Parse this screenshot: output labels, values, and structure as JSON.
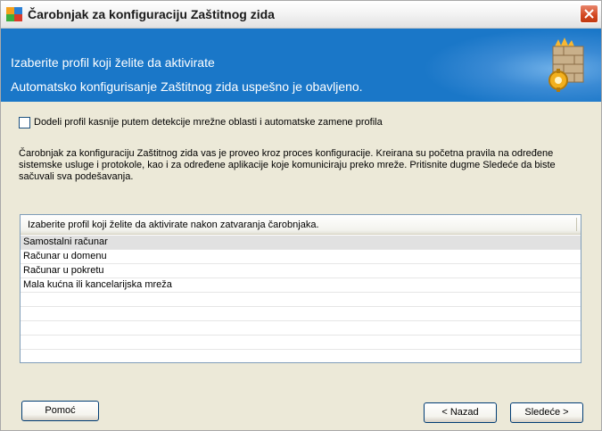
{
  "window": {
    "title": "Čarobnjak za konfiguraciju Zaštitnog zida",
    "icon": "avg-logo-icon",
    "close_icon": "close-icon"
  },
  "banner": {
    "heading": "Izaberite profil koji želite da aktivirate",
    "subheading": "Automatsko konfigurisanje Zaštitnog zida uspešno je obavljeno.",
    "icon": "firewall-wizard-icon",
    "background_color": "#1a77c8"
  },
  "checkbox": {
    "label": "Dodeli profil kasnije putem detekcije mrežne oblasti i automatske zamene profila",
    "checked": false
  },
  "description": "Čarobnjak za konfiguraciju Zaštitnog zida vas je proveo kroz proces konfiguracije. Kreirana su početna pravila na određene sistemske usluge i protokole, kao i za određene aplikacije koje komuniciraju preko mreže. Pritisnite dugme Sledeće da biste sačuvali sva podešavanja.",
  "profile_list": {
    "header": "Izaberite profil koji želite da aktivirate nakon zatvaranja čarobnjaka.",
    "items": [
      "Samostalni računar",
      "Računar u domenu",
      "Računar u pokretu",
      "Mala kućna ili kancelarijska mreža"
    ],
    "selected_index": 0
  },
  "buttons": {
    "help": "Pomoć",
    "back": "< Nazad",
    "next": "Sledeće >"
  }
}
